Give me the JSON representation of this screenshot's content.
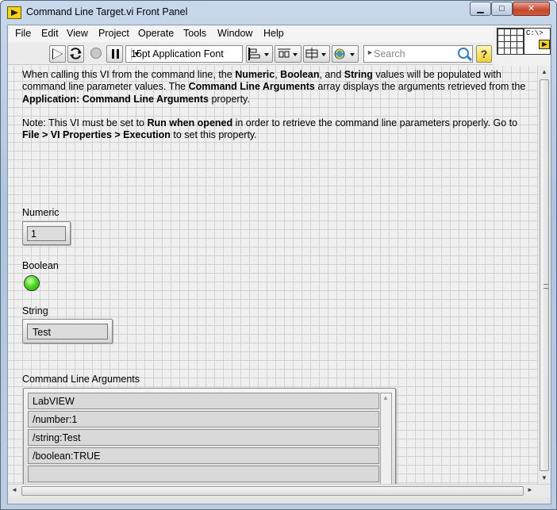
{
  "window": {
    "title": "Command Line Target.vi Front Panel",
    "controls": {
      "minimize": "▁",
      "maximize": "□",
      "close": "✕"
    }
  },
  "menu": [
    "File",
    "Edit",
    "View",
    "Project",
    "Operate",
    "Tools",
    "Window",
    "Help"
  ],
  "toolbar": {
    "font": "15pt Application Font",
    "search_placeholder": "Search",
    "help": "?"
  },
  "vi_icon": {
    "text": "C:\\>"
  },
  "description": {
    "p1": [
      {
        "t": "When calling this VI from the command line, the ",
        "b": false
      },
      {
        "t": "Numeric",
        "b": true
      },
      {
        "t": ", ",
        "b": false
      },
      {
        "t": "Boolean",
        "b": true
      },
      {
        "t": ", and ",
        "b": false
      },
      {
        "t": "String",
        "b": true
      },
      {
        "t": " values will be populated with command line parameter values. The ",
        "b": false
      },
      {
        "t": "Command Line Arguments",
        "b": true
      },
      {
        "t": " array displays the arguments retrieved from the ",
        "b": false
      },
      {
        "t": "Application: Command Line Arguments",
        "b": true
      },
      {
        "t": " property.",
        "b": false
      }
    ],
    "p2": [
      {
        "t": "Note: This VI must be set to ",
        "b": false
      },
      {
        "t": "Run when opened",
        "b": true
      },
      {
        "t": " in order to retrieve the command line parameters properly. Go to ",
        "b": false
      },
      {
        "t": "File > VI Properties > Execution",
        "b": true
      },
      {
        "t": " to set this property.",
        "b": false
      }
    ]
  },
  "controls": {
    "numeric": {
      "label": "Numeric",
      "value": "1"
    },
    "boolean": {
      "label": "Boolean",
      "state": true,
      "color": "#3fd21a"
    },
    "string": {
      "label": "String",
      "value": "Test"
    },
    "array": {
      "label": "Command Line Arguments",
      "items": [
        "LabVIEW",
        "/number:1",
        "/string:Test",
        "/boolean:TRUE",
        "",
        ""
      ]
    }
  }
}
